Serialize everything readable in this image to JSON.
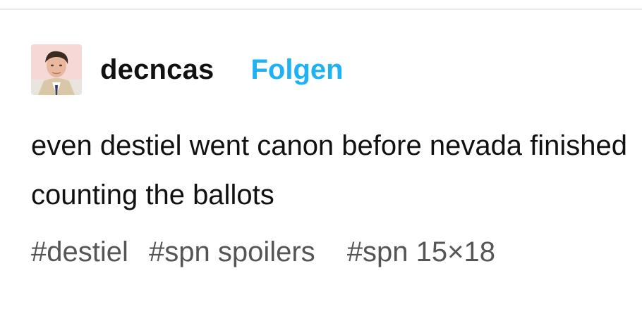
{
  "post": {
    "author": {
      "username": "decncas",
      "avatar_alt": "avatar"
    },
    "follow_label": "Folgen",
    "text": "even destiel went canon before nevada finished counting the ballots",
    "tags": [
      "#destiel",
      "#spn spoilers",
      "#spn 15×18"
    ]
  },
  "colors": {
    "follow": "#1cb2f5",
    "text": "#111111",
    "tags": "#555555",
    "divider": "#ececec"
  }
}
